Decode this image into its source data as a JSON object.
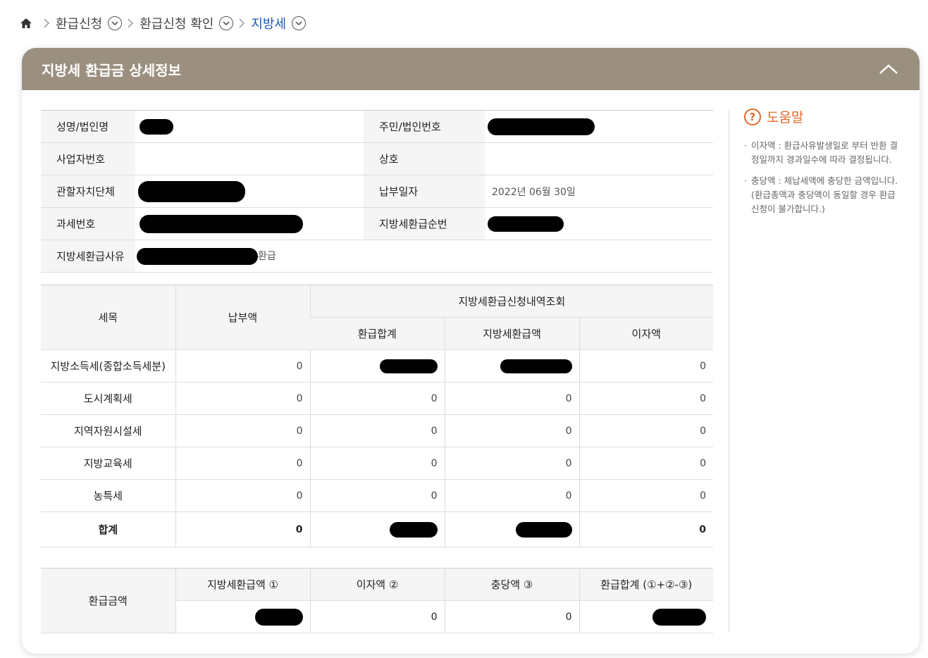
{
  "breadcrumb": {
    "items": [
      {
        "label": "환급신청"
      },
      {
        "label": "환급신청 확인"
      },
      {
        "label": "지방세"
      }
    ]
  },
  "card": {
    "title": "지방세 환급금 상세정보"
  },
  "info": {
    "name_label": "성명/법인명",
    "resident_label": "주민/법인번호",
    "business_label": "사업자번호",
    "company_label": "상호",
    "jurisdiction_label": "관할자치단체",
    "payment_date_label": "납부일자",
    "payment_date_value": "2022년 06월 30일",
    "tax_number_label": "과세번호",
    "refund_seq_label": "지방세환급순번",
    "reason_label": "지방세환급사유",
    "reason_suffix": "환급"
  },
  "tax_table": {
    "headers": {
      "item": "세목",
      "paid": "납부액",
      "group": "지방세환급신청내역조회",
      "refund_total": "환급합계",
      "local_refund": "지방세환급액",
      "interest": "이자액"
    },
    "rows": [
      {
        "name": "지방소득세(종합소득세분)",
        "paid": "0",
        "interest": "0"
      },
      {
        "name": "도시계획세",
        "paid": "0",
        "refund_total": "0",
        "local_refund": "0",
        "interest": "0"
      },
      {
        "name": "지역자원시설세",
        "paid": "0",
        "refund_total": "0",
        "local_refund": "0",
        "interest": "0"
      },
      {
        "name": "지방교육세",
        "paid": "0",
        "refund_total": "0",
        "local_refund": "0",
        "interest": "0"
      },
      {
        "name": "농특세",
        "paid": "0",
        "refund_total": "0",
        "local_refund": "0",
        "interest": "0"
      },
      {
        "name": "합계",
        "paid": "0",
        "interest": "0"
      }
    ]
  },
  "refund_table": {
    "row_header": "환급금액",
    "headers": [
      "지방세환급액 ①",
      "이자액 ②",
      "충당액 ③",
      "환급합계 (①+②-③)"
    ],
    "interest": "0",
    "offset": "0"
  },
  "help": {
    "title": "도움말",
    "items": [
      "이자액 : 환급사유발생일로 부터 반환 결정일까지 경과일수에 따라 결정됩니다.",
      "충당액 : 체납세액에 충당한 금액입니다. (환급총액과 충당액이 동일할 경우 환급신청이 불가합니다.)"
    ]
  },
  "colors": {
    "header_bg": "#9b9080",
    "accent_link": "#1a56b8",
    "help_accent": "#e06a2c"
  }
}
